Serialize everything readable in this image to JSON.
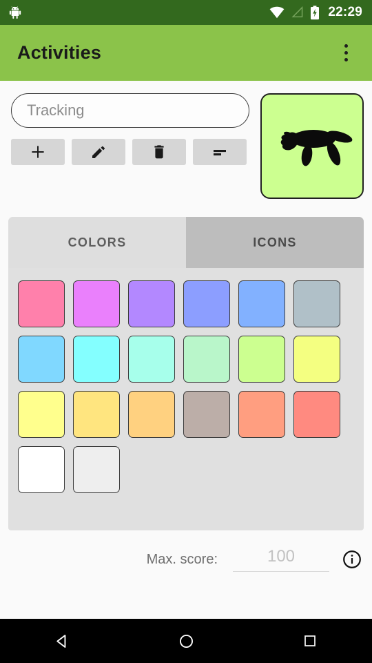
{
  "status_bar": {
    "time": "22:29",
    "icons": [
      "android-robot-icon",
      "wifi-icon",
      "cell-signal-icon",
      "battery-charging-icon"
    ],
    "background": "#33691E"
  },
  "app_bar": {
    "title": "Activities",
    "background": "#8BC34A",
    "overflow_label": "more-options"
  },
  "form": {
    "name_field": {
      "value": "",
      "placeholder": "Tracking"
    },
    "buttons": [
      {
        "name": "add-button",
        "icon": "plus-icon"
      },
      {
        "name": "edit-button",
        "icon": "pencil-icon"
      },
      {
        "name": "delete-button",
        "icon": "trash-icon"
      },
      {
        "name": "sort-button",
        "icon": "sort-lines-icon"
      }
    ],
    "avatar": {
      "icon": "turtle-icon",
      "background": "#CCFF90",
      "border": "#212121"
    }
  },
  "tabs": [
    {
      "label": "COLORS",
      "active": false
    },
    {
      "label": "ICONS",
      "active": true
    }
  ],
  "colors": {
    "panel_background": "#E0E0E0",
    "swatches": [
      "#FF80AB",
      "#EA80FC",
      "#B388FF",
      "#8C9EFF",
      "#82B1FF",
      "#B0C0C8",
      "#80D8FF",
      "#84FFFF",
      "#A7FFEB",
      "#B9F6CA",
      "#CCFF90",
      "#F4FF81",
      "#FFFF8D",
      "#FFE57F",
      "#FFD180",
      "#BCAEA8",
      "#FF9E80",
      "#FF8A80",
      "#FFFFFF",
      "#EEEEEE"
    ]
  },
  "score": {
    "label": "Max. score:",
    "value": "",
    "placeholder": "100",
    "info_icon": "info-circle-icon"
  },
  "nav_bar": {
    "back": "back-triangle-icon",
    "home": "home-circle-icon",
    "recents": "recents-square-icon",
    "background": "#000000"
  }
}
